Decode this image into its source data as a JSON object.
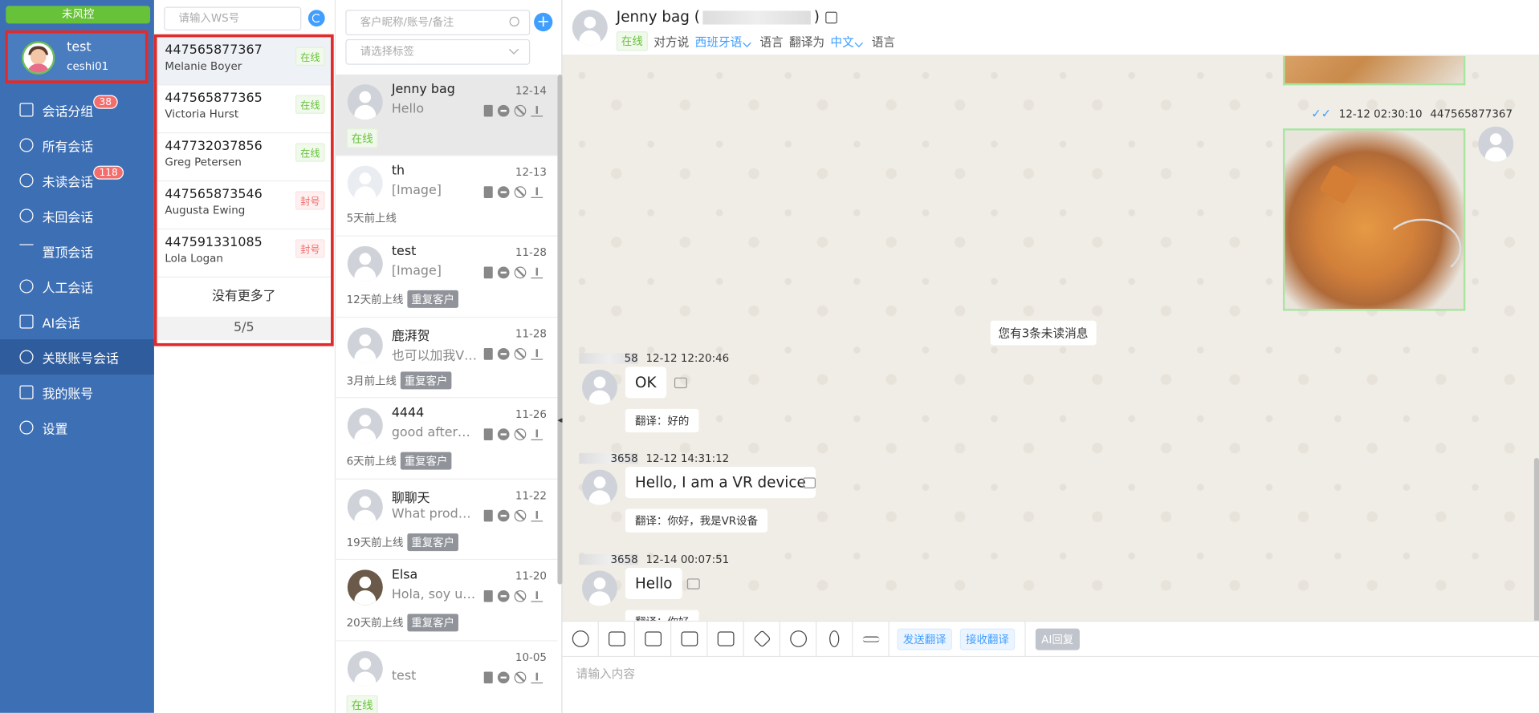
{
  "sidebar": {
    "risk_label": "未风控",
    "user": {
      "name": "test",
      "id": "ceshi01"
    },
    "items": [
      {
        "label": "会话分组",
        "badge": "38"
      },
      {
        "label": "所有会话"
      },
      {
        "label": "未读会话",
        "badge": "118"
      },
      {
        "label": "未回会话"
      },
      {
        "label": "置顶会话"
      },
      {
        "label": "人工会话"
      },
      {
        "label": "AI会话"
      },
      {
        "label": "关联账号会话"
      },
      {
        "label": "我的账号"
      },
      {
        "label": "设置"
      }
    ]
  },
  "ws": {
    "search_placeholder": "请输入WS号",
    "accounts": [
      {
        "number": "447565877367",
        "name": "Melanie Boyer",
        "status": "在线"
      },
      {
        "number": "447565877365",
        "name": "Victoria Hurst",
        "status": "在线"
      },
      {
        "number": "447732037856",
        "name": "Greg Petersen",
        "status": "在线"
      },
      {
        "number": "447565873546",
        "name": "Augusta Ewing",
        "status": "封号"
      },
      {
        "number": "447591331085",
        "name": "Lola Logan",
        "status": "封号"
      }
    ],
    "no_more": "没有更多了",
    "pager": "5/5"
  },
  "conv": {
    "search_placeholder": "客户昵称/账号/备注",
    "tag_placeholder": "请选择标签",
    "items": [
      {
        "name": "Jenny bag",
        "date": "12-14",
        "msg": "Hello",
        "foot": "",
        "online": "在线",
        "repeat": ""
      },
      {
        "name": "th",
        "date": "12-13",
        "msg": "[Image]",
        "foot": "5天前上线",
        "online": "",
        "repeat": ""
      },
      {
        "name": "test",
        "date": "11-28",
        "msg": "[Image]",
        "foot": "12天前上线",
        "online": "",
        "repeat": "重复客户"
      },
      {
        "name": "鹿湃贺",
        "date": "11-28",
        "msg": "也可以加我V…",
        "foot": "3月前上线",
        "online": "",
        "repeat": "重复客户"
      },
      {
        "name": "4444",
        "date": "11-26",
        "msg": "good afternoon",
        "foot": "6天前上线",
        "online": "",
        "repeat": "重复客户"
      },
      {
        "name": "聊聊天",
        "date": "11-22",
        "msg": "What produc…",
        "foot": "19天前上线",
        "online": "",
        "repeat": "重复客户"
      },
      {
        "name": "Elsa",
        "date": "11-20",
        "msg": "Hola, soy un…",
        "foot": "20天前上线",
        "online": "",
        "repeat": "重复客户"
      },
      {
        "name": "",
        "date": "10-05",
        "msg": "test",
        "foot": "",
        "online": "在线",
        "repeat": ""
      }
    ]
  },
  "chat": {
    "name": "Jenny bag",
    "paren_open": "(",
    "paren_close": ")",
    "status": "在线",
    "peer_says": "对方说",
    "peer_lang": "西班牙语",
    "lang_word": "语言",
    "translate_to": "翻译为",
    "target_lang": "中文",
    "lang_word2": "语言",
    "out_meta_time": "12-12 02:30:10",
    "out_meta_acc": "447565877367",
    "unread_notice": "您有3条未读消息",
    "messages": [
      {
        "sender_tail": "58",
        "time": "12-12 12:20:46",
        "text": "OK",
        "translation": "翻译：好的"
      },
      {
        "sender_tail": "3658",
        "time": "12-12 14:31:12",
        "text": "Hello, I am a VR device",
        "translation": "翻译：你好，我是VR设备"
      },
      {
        "sender_tail": "3658",
        "time": "12-14 00:07:51",
        "text": "Hello",
        "translation": "翻译：你好"
      }
    ],
    "send_translate": "发送翻译",
    "receive_translate": "接收翻译",
    "ai_reply": "AI回复",
    "input_placeholder": "请输入内容"
  },
  "colors": {
    "sidebar": "#3d6fb5",
    "accent": "#409eff",
    "online": "#67c23a",
    "banned": "#f56c6c",
    "highlight": "#e02b2b"
  }
}
